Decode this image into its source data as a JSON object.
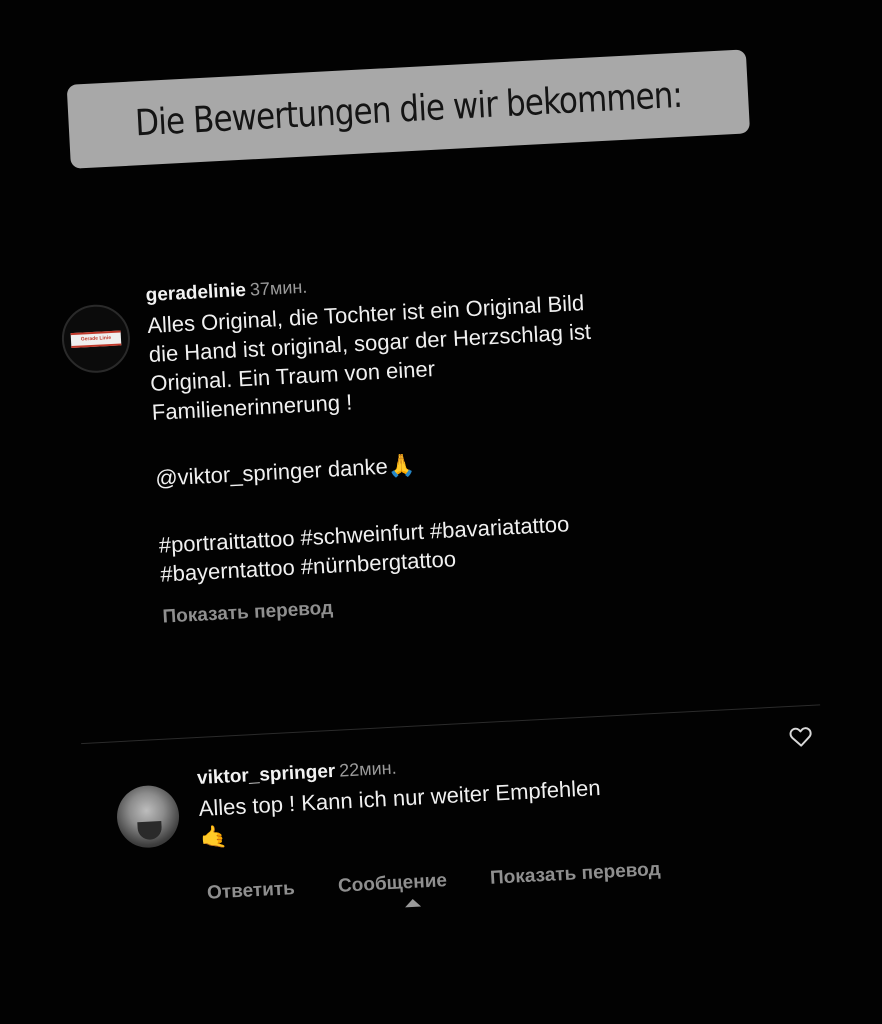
{
  "banner": {
    "text": "Die Bewertungen die wir bekommen:"
  },
  "comment1": {
    "username": "geradelinie",
    "time": "37мин.",
    "avatar_logo_text": "Gerade Linie",
    "lines": [
      "Alles Original, die Tochter ist ein Original Bild",
      "die Hand ist original, sogar der Herzschlag ist",
      "Original. Ein Traum von einer",
      "Familienerinnerung !"
    ],
    "mention": "@viktor_springer danke",
    "mention_emoji": "🙏",
    "hashtags_line1": "#portraittattoo #schweinfurt #bavariatattoo",
    "hashtags_line2": "#bayerntattoo #nürnbergtattoo",
    "translate_label": "Показать перевод"
  },
  "comment2": {
    "username": "viktor_springer",
    "time": "22мин.",
    "text": "Alles top ! Kann ich nur weiter Empfehlen",
    "emoji": "🤙",
    "heart_icon": "heart-outline-icon",
    "actions": {
      "reply": "Ответить",
      "message": "Сообщение",
      "translate": "Показать перевод"
    }
  },
  "colors": {
    "background": "#020202",
    "banner": "#a8a8a8",
    "muted_text": "#8f8f8f",
    "primary_text": "#f0f0f0"
  }
}
